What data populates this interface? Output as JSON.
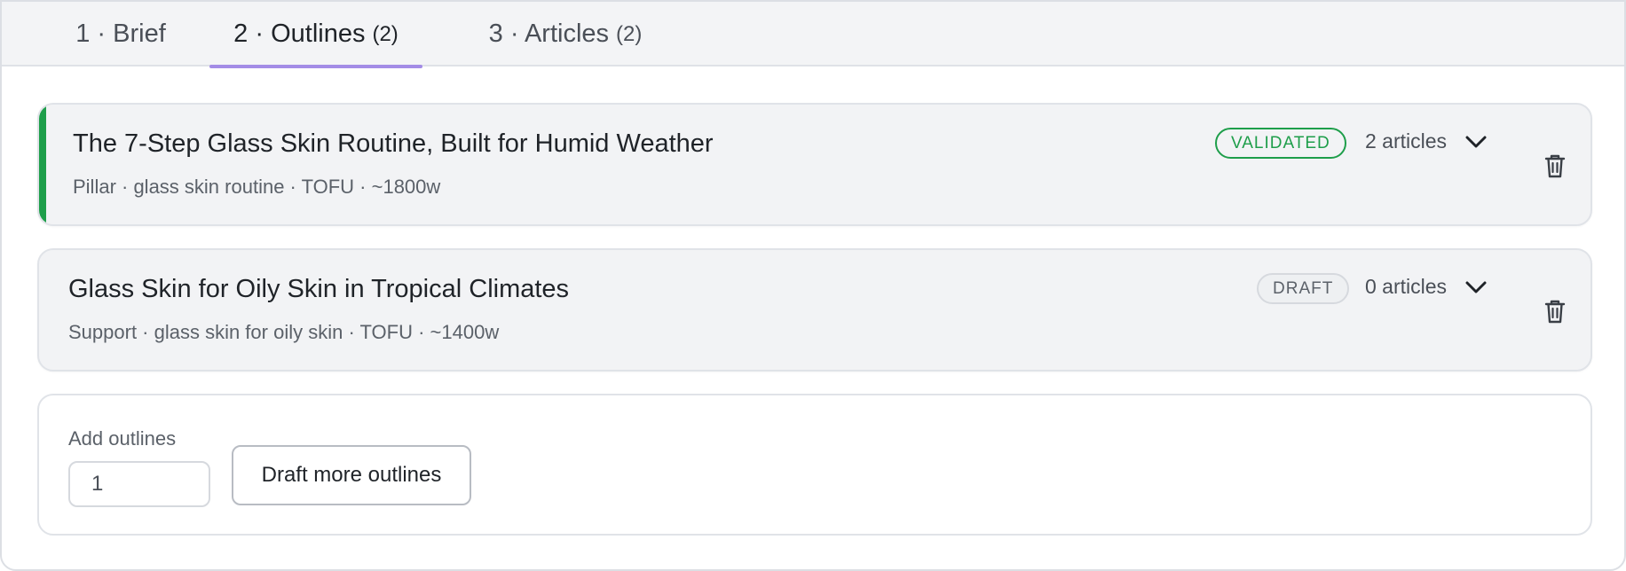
{
  "tabs": [
    {
      "label": "1 · Brief",
      "count": ""
    },
    {
      "label": "2 · Outlines",
      "count": "(2)"
    },
    {
      "label": "3 · Articles",
      "count": "(2)"
    }
  ],
  "active_tab": "2 · Outlines",
  "outlines": [
    {
      "title": "The 7-Step Glass Skin Routine, Built for Humid Weather",
      "meta": "Pillar · glass skin routine · TOFU · ~1800w",
      "status": "VALIDATED",
      "articles": "2 articles",
      "expand_icon": "chevron-down-icon",
      "delete_icon": "trash-icon"
    },
    {
      "title": "Glass Skin for Oily Skin in Tropical Climates",
      "meta": "Support · glass skin for oily skin · TOFU · ~1400w",
      "status": "DRAFT",
      "articles": "0 articles",
      "expand_icon": "chevron-down-icon",
      "delete_icon": "trash-icon"
    }
  ],
  "add_outlines": {
    "label": "Add outlines",
    "value": "1",
    "button_label": "Draft more outlines"
  },
  "colors": {
    "accent_tab": "#a38ce6",
    "validated": "#1e9e4a",
    "draft_border": "#d6d9de"
  }
}
